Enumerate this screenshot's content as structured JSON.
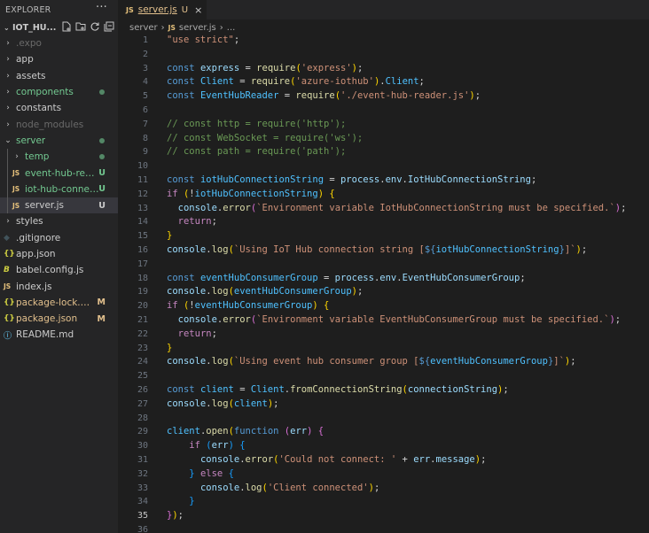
{
  "explorer": {
    "title": "EXPLORER",
    "more": "···",
    "project": "IOT_HU..."
  },
  "tree": [
    {
      "label": ".expo",
      "type": "folder",
      "color": "dim"
    },
    {
      "label": "app",
      "type": "folder"
    },
    {
      "label": "assets",
      "type": "folder"
    },
    {
      "label": "components",
      "type": "folder",
      "color": "green",
      "dot": true
    },
    {
      "label": "constants",
      "type": "folder"
    },
    {
      "label": "node_modules",
      "type": "folder",
      "color": "dim"
    },
    {
      "label": "server",
      "type": "folder",
      "open": true,
      "color": "green",
      "dot": true
    },
    {
      "label": "temp",
      "type": "folder",
      "color": "green",
      "dot": true,
      "indent": 1
    },
    {
      "label": "event-hub-rea...",
      "type": "js",
      "color": "green",
      "status": "U",
      "indent": 1
    },
    {
      "label": "iot-hub-connec...",
      "type": "js",
      "color": "green",
      "status": "U",
      "indent": 1
    },
    {
      "label": "server.js",
      "type": "js",
      "color": "plain",
      "status": "U",
      "indent": 1,
      "selected": true
    },
    {
      "label": "styles",
      "type": "folder"
    },
    {
      "label": ".gitignore",
      "type": "git"
    },
    {
      "label": "app.json",
      "type": "json"
    },
    {
      "label": "babel.config.js",
      "type": "babel"
    },
    {
      "label": "index.js",
      "type": "js"
    },
    {
      "label": "package-lock.json",
      "type": "json",
      "color": "mod",
      "status": "M"
    },
    {
      "label": "package.json",
      "type": "json",
      "color": "mod",
      "status": "M"
    },
    {
      "label": "README.md",
      "type": "info"
    }
  ],
  "tab": {
    "badge": "JS",
    "name": "server.js",
    "status": "U",
    "close": "×"
  },
  "breadcrumb": {
    "folder": "server",
    "sep": "›",
    "badge": "JS",
    "file": "server.js",
    "sep2": "›",
    "more": "..."
  },
  "active_line": 35,
  "code": [
    [
      [
        "s",
        "\"use strict\""
      ],
      [
        "p",
        ";"
      ]
    ],
    [],
    [
      [
        "k",
        "const "
      ],
      [
        "v",
        "express"
      ],
      [
        "p",
        " = "
      ],
      [
        "f",
        "require"
      ],
      [
        "b1",
        "("
      ],
      [
        "s",
        "'express'"
      ],
      [
        "b1",
        ")"
      ],
      [
        "p",
        ";"
      ]
    ],
    [
      [
        "k",
        "const "
      ],
      [
        "cn",
        "Client"
      ],
      [
        "p",
        " = "
      ],
      [
        "f",
        "require"
      ],
      [
        "b1",
        "("
      ],
      [
        "s",
        "'azure-iothub'"
      ],
      [
        "b1",
        ")"
      ],
      [
        "p",
        "."
      ],
      [
        "cn",
        "Client"
      ],
      [
        "p",
        ";"
      ]
    ],
    [
      [
        "k",
        "const "
      ],
      [
        "cn",
        "EventHubReader"
      ],
      [
        "p",
        " = "
      ],
      [
        "f",
        "require"
      ],
      [
        "b1",
        "("
      ],
      [
        "s",
        "'./event-hub-reader.js'"
      ],
      [
        "b1",
        ")"
      ],
      [
        "p",
        ";"
      ]
    ],
    [],
    [
      [
        "cm",
        "// const http = require('http');"
      ]
    ],
    [
      [
        "cm",
        "// const WebSocket = require('ws');"
      ]
    ],
    [
      [
        "cm",
        "// const path = require('path');"
      ]
    ],
    [],
    [
      [
        "k",
        "const "
      ],
      [
        "cn",
        "iotHubConnectionString"
      ],
      [
        "p",
        " = "
      ],
      [
        "v",
        "process"
      ],
      [
        "p",
        "."
      ],
      [
        "v",
        "env"
      ],
      [
        "p",
        "."
      ],
      [
        "v",
        "IotHubConnectionString"
      ],
      [
        "p",
        ";"
      ]
    ],
    [
      [
        "kc",
        "if "
      ],
      [
        "b1",
        "("
      ],
      [
        "p",
        "!"
      ],
      [
        "cn",
        "iotHubConnectionString"
      ],
      [
        "b1",
        ")"
      ],
      [
        "p",
        " "
      ],
      [
        "b1",
        "{"
      ]
    ],
    [
      [
        "p",
        "  "
      ],
      [
        "v",
        "console"
      ],
      [
        "p",
        "."
      ],
      [
        "f",
        "error"
      ],
      [
        "b2",
        "("
      ],
      [
        "s",
        "`Environment variable IotHubConnectionString must be specified.`"
      ],
      [
        "b2",
        ")"
      ],
      [
        "p",
        ";"
      ]
    ],
    [
      [
        "p",
        "  "
      ],
      [
        "kc",
        "return"
      ],
      [
        "p",
        ";"
      ]
    ],
    [
      [
        "b1",
        "}"
      ]
    ],
    [
      [
        "v",
        "console"
      ],
      [
        "p",
        "."
      ],
      [
        "f",
        "log"
      ],
      [
        "b1",
        "("
      ],
      [
        "s",
        "`Using IoT Hub connection string ["
      ],
      [
        "k",
        "${"
      ],
      [
        "cn",
        "iotHubConnectionString"
      ],
      [
        "k",
        "}"
      ],
      [
        "s",
        "]`"
      ],
      [
        "b1",
        ")"
      ],
      [
        "p",
        ";"
      ]
    ],
    [],
    [
      [
        "k",
        "const "
      ],
      [
        "cn",
        "eventHubConsumerGroup"
      ],
      [
        "p",
        " = "
      ],
      [
        "v",
        "process"
      ],
      [
        "p",
        "."
      ],
      [
        "v",
        "env"
      ],
      [
        "p",
        "."
      ],
      [
        "v",
        "EventHubConsumerGroup"
      ],
      [
        "p",
        ";"
      ]
    ],
    [
      [
        "v",
        "console"
      ],
      [
        "p",
        "."
      ],
      [
        "f",
        "log"
      ],
      [
        "b1",
        "("
      ],
      [
        "cn",
        "eventHubConsumerGroup"
      ],
      [
        "b1",
        ")"
      ],
      [
        "p",
        ";"
      ]
    ],
    [
      [
        "kc",
        "if "
      ],
      [
        "b1",
        "("
      ],
      [
        "p",
        "!"
      ],
      [
        "cn",
        "eventHubConsumerGroup"
      ],
      [
        "b1",
        ")"
      ],
      [
        "p",
        " "
      ],
      [
        "b1",
        "{"
      ]
    ],
    [
      [
        "p",
        "  "
      ],
      [
        "v",
        "console"
      ],
      [
        "p",
        "."
      ],
      [
        "f",
        "error"
      ],
      [
        "b2",
        "("
      ],
      [
        "s",
        "`Environment variable EventHubConsumerGroup must be specified.`"
      ],
      [
        "b2",
        ")"
      ],
      [
        "p",
        ";"
      ]
    ],
    [
      [
        "p",
        "  "
      ],
      [
        "kc",
        "return"
      ],
      [
        "p",
        ";"
      ]
    ],
    [
      [
        "b1",
        "}"
      ]
    ],
    [
      [
        "v",
        "console"
      ],
      [
        "p",
        "."
      ],
      [
        "f",
        "log"
      ],
      [
        "b1",
        "("
      ],
      [
        "s",
        "`Using event hub consumer group ["
      ],
      [
        "k",
        "${"
      ],
      [
        "cn",
        "eventHubConsumerGroup"
      ],
      [
        "k",
        "}"
      ],
      [
        "s",
        "]`"
      ],
      [
        "b1",
        ")"
      ],
      [
        "p",
        ";"
      ]
    ],
    [],
    [
      [
        "k",
        "const "
      ],
      [
        "cn",
        "client"
      ],
      [
        "p",
        " = "
      ],
      [
        "cn",
        "Client"
      ],
      [
        "p",
        "."
      ],
      [
        "f",
        "fromConnectionString"
      ],
      [
        "b1",
        "("
      ],
      [
        "v",
        "connectionString"
      ],
      [
        "b1",
        ")"
      ],
      [
        "p",
        ";"
      ]
    ],
    [
      [
        "v",
        "console"
      ],
      [
        "p",
        "."
      ],
      [
        "f",
        "log"
      ],
      [
        "b1",
        "("
      ],
      [
        "cn",
        "client"
      ],
      [
        "b1",
        ")"
      ],
      [
        "p",
        ";"
      ]
    ],
    [],
    [
      [
        "cn",
        "client"
      ],
      [
        "p",
        "."
      ],
      [
        "f",
        "open"
      ],
      [
        "b1",
        "("
      ],
      [
        "k",
        "function "
      ],
      [
        "b2",
        "("
      ],
      [
        "v",
        "err"
      ],
      [
        "b2",
        ")"
      ],
      [
        "p",
        " "
      ],
      [
        "b2",
        "{"
      ]
    ],
    [
      [
        "p",
        "    "
      ],
      [
        "kc",
        "if "
      ],
      [
        "b3",
        "("
      ],
      [
        "v",
        "err"
      ],
      [
        "b3",
        ")"
      ],
      [
        "p",
        " "
      ],
      [
        "b3",
        "{"
      ]
    ],
    [
      [
        "p",
        "      "
      ],
      [
        "v",
        "console"
      ],
      [
        "p",
        "."
      ],
      [
        "f",
        "error"
      ],
      [
        "b1",
        "("
      ],
      [
        "s",
        "'Could not connect: '"
      ],
      [
        "p",
        " + "
      ],
      [
        "v",
        "err"
      ],
      [
        "p",
        "."
      ],
      [
        "v",
        "message"
      ],
      [
        "b1",
        ")"
      ],
      [
        "p",
        ";"
      ]
    ],
    [
      [
        "p",
        "    "
      ],
      [
        "b3",
        "}"
      ],
      [
        "p",
        " "
      ],
      [
        "kc",
        "else "
      ],
      [
        "b3",
        "{"
      ]
    ],
    [
      [
        "p",
        "      "
      ],
      [
        "v",
        "console"
      ],
      [
        "p",
        "."
      ],
      [
        "f",
        "log"
      ],
      [
        "b1",
        "("
      ],
      [
        "s",
        "'Client connected'"
      ],
      [
        "b1",
        ")"
      ],
      [
        "p",
        ";"
      ]
    ],
    [
      [
        "p",
        "    "
      ],
      [
        "b3",
        "}"
      ]
    ],
    [
      [
        "b2",
        "}"
      ],
      [
        "b1",
        ")"
      ],
      [
        "p",
        ";"
      ]
    ],
    []
  ]
}
